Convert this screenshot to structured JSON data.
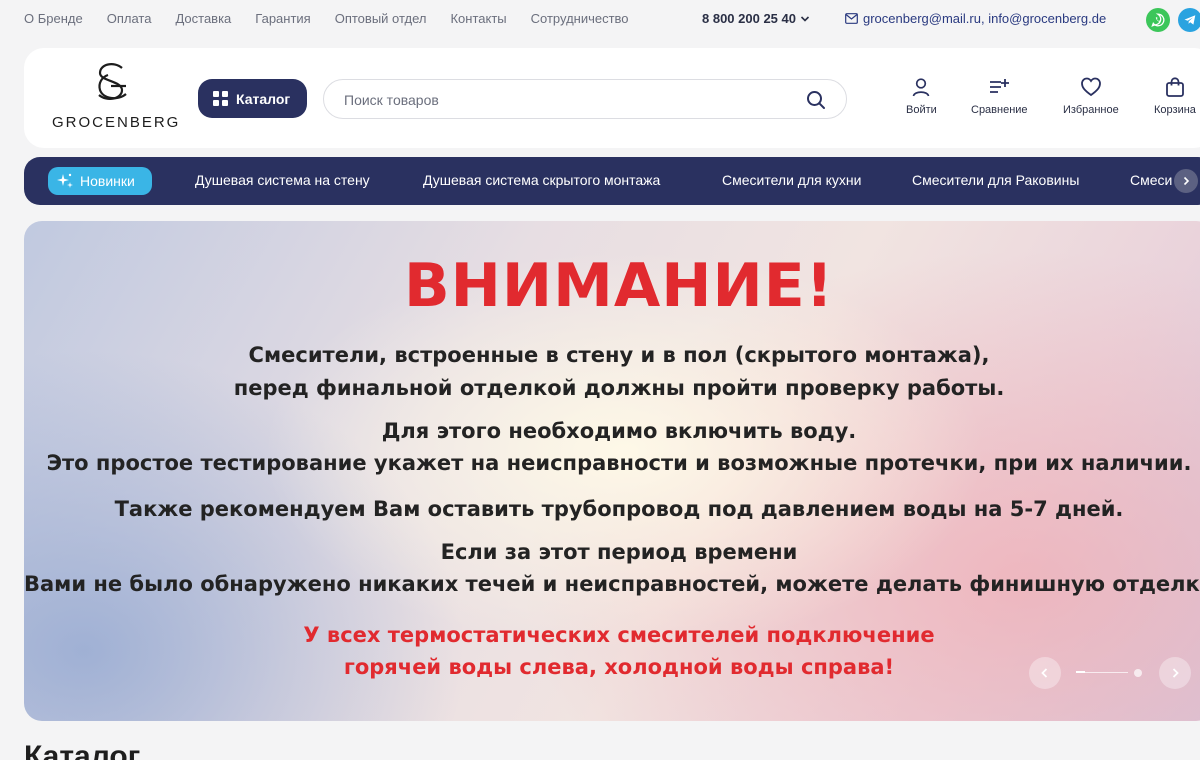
{
  "topbar": {
    "links": [
      "О Бренде",
      "Оплата",
      "Доставка",
      "Гарантия",
      "Оптовый отдел",
      "Контакты",
      "Сотрудничество"
    ],
    "phone": "8 800 200 25 40",
    "email": "grocenberg@mail.ru, info@grocenberg.de",
    "icons": {
      "phone_dropdown": "chevron-down-icon",
      "mail": "mail-icon",
      "whatsapp": "whatsapp-icon",
      "telegram": "telegram-icon"
    },
    "colors": {
      "whatsapp": "#3cc65a",
      "telegram": "#2aa3e0"
    }
  },
  "header": {
    "logo_text": "GROCENBERG",
    "catalog_label": "Каталог",
    "search": {
      "placeholder": "Поиск товаров",
      "value": ""
    },
    "actions": {
      "login": "Войти",
      "compare": "Сравнение",
      "favorites": "Избранное",
      "cart": "Корзина"
    }
  },
  "nav": {
    "new_label": "Новинки",
    "items": [
      "Душевая система на стену",
      "Душевая система скрытого монтажа",
      "Смесители для кухни",
      "Смесители для Раковины",
      "Смеси"
    ],
    "colors": {
      "bg": "#2a3160",
      "pill": "#3ab5e6"
    }
  },
  "banner": {
    "title": "ВНИМАНИЕ!",
    "lines": [
      "Смесители, встроенные в стену и в пол (скрытого монтажа),",
      "перед финальной отделкой должны пройти проверку работы.",
      "Для этого необходимо включить воду.",
      "Это простое тестирование укажет на неисправности и возможные протечки, при их наличии.",
      "Также рекомендуем Вам оставить трубопровод под давлением воды на 5-7 дней.",
      "Если за этот период времени",
      "Вами не было обнаружено никаких течей и неисправностей, можете делать финишную отделку."
    ],
    "red_lines": [
      "У всех термостатических смесителей подключение",
      "горячей воды слева, холодной воды справа!"
    ],
    "slider": {
      "current": 1,
      "total": 2
    },
    "colors": {
      "accent_red": "#e12a2f"
    }
  },
  "section": {
    "title": "Каталог"
  }
}
